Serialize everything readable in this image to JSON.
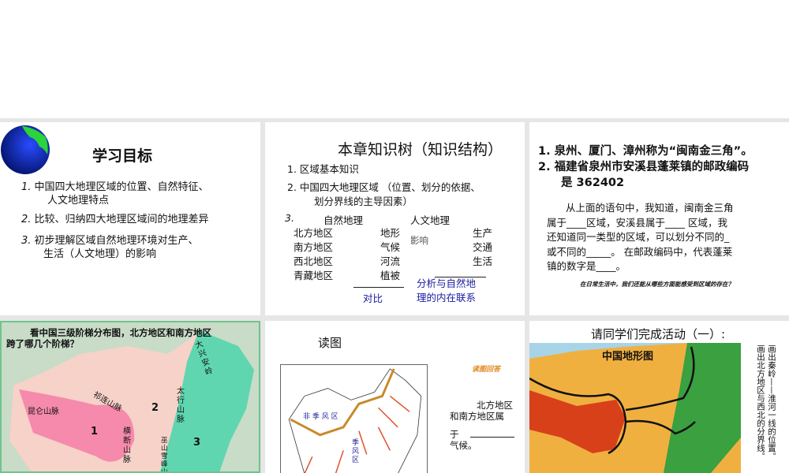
{
  "slides": [
    {
      "title": "学习目标",
      "items": [
        {
          "num": "1.",
          "line1": "中国四大地理区域的位置、自然特征、",
          "line2": "人文地理特点"
        },
        {
          "num": "2.",
          "line1": "比较、归纳四大地理区域间的地理差异",
          "line2": ""
        },
        {
          "num": "3.",
          "line1": "初步理解区域自然地理环境对生产、",
          "line2": "生活（人文地理）的影响"
        }
      ]
    },
    {
      "title": "本章知识树（知识结构）",
      "item1": "1. 区域基本知识",
      "item2a": "2. 中国四大地理区域 （位置、划分的依据、",
      "item2b": "划分界线的主导因素）",
      "item3_num": "3.",
      "natural_header": "自然地理",
      "human_header": "人文地理",
      "regions": [
        "北方地区",
        "南方地区",
        "西北地区",
        "青藏地区"
      ],
      "natural_factors": [
        "地形",
        "气候",
        "河流",
        "植被"
      ],
      "influence": "影响",
      "human_factors": [
        "生产",
        "交通",
        "生活"
      ],
      "compare": "对比",
      "analysis": [
        "分析与自然地",
        "理的内在联系"
      ],
      "accent_color": "#1a1aa0"
    },
    {
      "line1": "1. 泉州、厦门、漳州称为“闽南金三角”。",
      "line2": "2. 福建省泉州市安溪县蓬莱镇的邮政编码",
      "line3": "是 362402",
      "para": [
        "从上面的语句中，我知道，闽南金三角",
        "属于____区域，安溪县属于____ 区域，我",
        "还知道同一类型的区域，可以划分不同的_",
        "或不同的_____。 在邮政编码中，代表蓬莱",
        "镇的数字是____。"
      ],
      "note": "在日常生活中，我们还能从哪些方面能感受到区域的存在？"
    },
    {
      "question": [
        "看中国三级阶梯分布图，北方地区和南方地区",
        "跨了哪几个阶梯？"
      ],
      "labels": {
        "kunlun": "昆仑山脉",
        "qilian": "祁连山脉",
        "hengduan": "横断山脉",
        "daxinganling": "大兴安岭",
        "taihang": "太行山脉",
        "wushan": "巫山 雪峰山",
        "step1": "1",
        "step2": "2",
        "step3": "3"
      }
    },
    {
      "title": "读图",
      "badge": "读图回答",
      "map_labels": {
        "non_monsoon": "非 季 风 区",
        "monsoon": "季 风 区"
      },
      "text": [
        "北方地区",
        "和南方地区属",
        "于",
        "气候。"
      ]
    },
    {
      "title": "请同学们完成活动（一）:",
      "map_title": "中国地形图",
      "instruction1": "画出秦岭——淮河一线的位置。",
      "instruction2": "画出北方地区与西北的分界线。"
    }
  ]
}
